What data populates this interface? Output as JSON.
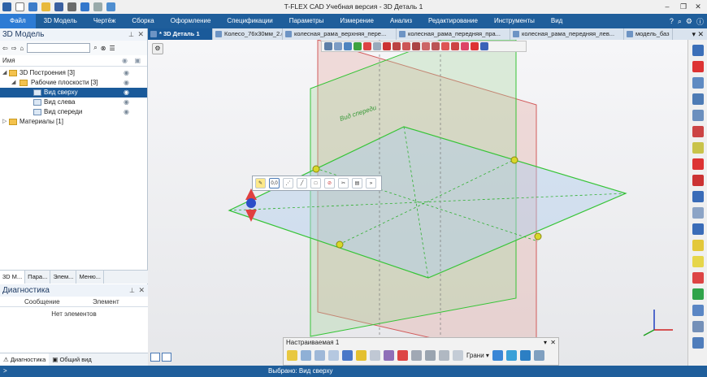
{
  "app": {
    "title": "T-FLEX CAD Учебная версия - 3D Деталь 1"
  },
  "menu": [
    "Файл",
    "3D Модель",
    "Чертёж",
    "Сборка",
    "Оформление",
    "Спецификации",
    "Параметры",
    "Измерение",
    "Анализ",
    "Редактирование",
    "Инструменты",
    "Вид"
  ],
  "model_panel": {
    "title": "3D Модель",
    "column_name": "Имя",
    "tree": [
      {
        "label": "3D Построения [3]",
        "level": 0,
        "expanded": true,
        "icon": "folder-icon"
      },
      {
        "label": "Рабочие плоскости [3]",
        "level": 1,
        "expanded": true,
        "icon": "folder-icon"
      },
      {
        "label": "Вид сверху",
        "level": 2,
        "selected": true,
        "icon": "plane-icon"
      },
      {
        "label": "Вид слева",
        "level": 2,
        "icon": "plane-icon"
      },
      {
        "label": "Вид спереди",
        "level": 2,
        "icon": "plane-icon"
      },
      {
        "label": "Материалы [1]",
        "level": 0,
        "expanded": false,
        "icon": "folder-icon"
      }
    ]
  },
  "left_tabs": [
    "3D М...",
    "Пара...",
    "Элем...",
    "Меню..."
  ],
  "diagnostics": {
    "title": "Диагностика",
    "col_message": "Сообщение",
    "col_element": "Элемент",
    "empty": "Нет элементов"
  },
  "bottom_tabs": [
    "Диагностика",
    "Общий вид"
  ],
  "doc_tabs": [
    "* 3D Деталь 1",
    "Колесо_76x30мм_2.grs",
    "колесная_рама_верхняя_пере...",
    "колесная_рама_передняя_пра...",
    "колесная_рама_передняя_лев...",
    "модель_баз"
  ],
  "viewport": {
    "plane_label": "Вид спереди"
  },
  "context_toolbar": {
    "dim_label": "0,0"
  },
  "custom_toolbar": {
    "title": "Настраиваемая 1",
    "faces_label": "Грани"
  },
  "status": {
    "prompt": ">",
    "text": "Выбрано: Вид сверху"
  },
  "colors": {
    "ribbon": "#1f5e9b",
    "file_tab": "#2d7bd4",
    "selection": "#1a5a9a",
    "green_plane": "#36c436",
    "red_plane": "#d25a5a"
  }
}
